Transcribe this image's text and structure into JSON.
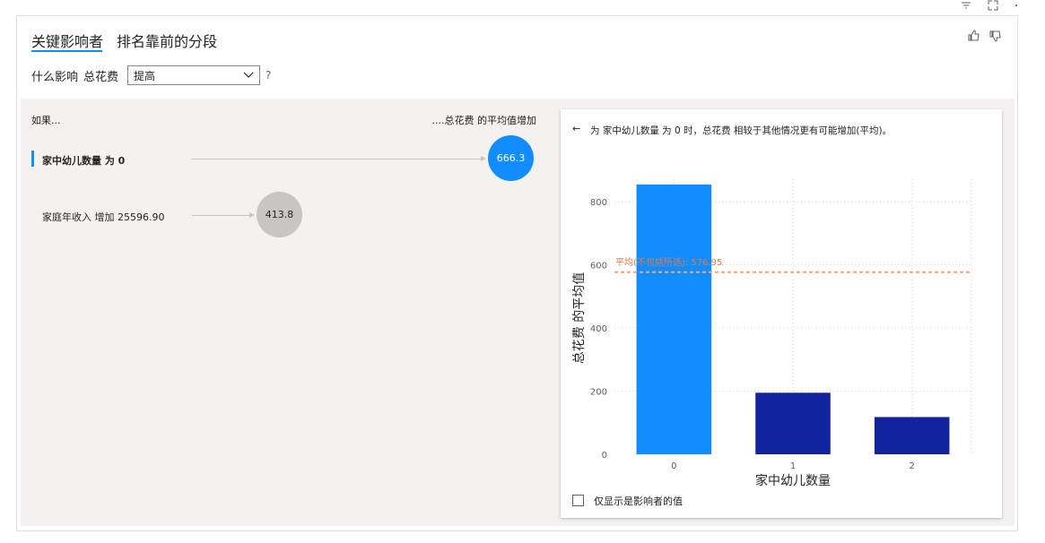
{
  "tabs": [
    {
      "label": "关键影响者",
      "active": true
    },
    {
      "label": "排名靠前的分段",
      "active": false
    }
  ],
  "header_icons": [
    "filter-icon",
    "focus-mode-icon",
    "more-options-icon"
  ],
  "feedback_icons": [
    "thumbs-up-icon",
    "thumbs-down-icon"
  ],
  "what_influences": {
    "label": "什么影响",
    "field": "总花费",
    "selected": "提高",
    "help": "?"
  },
  "left_panel": {
    "if_header": "如果...",
    "then_header": "....总花费 的平均值增加",
    "influencers": [
      {
        "label": "家中幼儿数量 为 0",
        "value": "666.3",
        "selected": true,
        "color": "#118dff"
      },
      {
        "label": "家庭年收入 增加 25596.90",
        "value": "413.8",
        "selected": false,
        "color": "#c8c6c4"
      }
    ]
  },
  "detail": {
    "back_arrow": "←",
    "description": "为 家中幼儿数量 为 0 时，总花费 相较于其他情况更有可能增加(平均)。",
    "checkbox_label": "仅显示是影响者的值",
    "checkbox_checked": false
  },
  "chart_data": {
    "type": "bar",
    "categories": [
      "0",
      "1",
      "2"
    ],
    "values": [
      855,
      195,
      118
    ],
    "bar_colors": [
      "#118dff",
      "#12239e",
      "#12239e"
    ],
    "xlabel": "家中幼儿数量",
    "ylabel": "总花费 的平均值",
    "ylim": [
      0,
      900
    ],
    "yticks": [
      0,
      200,
      400,
      600,
      800
    ],
    "grid": true,
    "reference_line": {
      "label": "平均(不包括所选): 576.95",
      "value": 576.95,
      "color": "#f2a37a"
    }
  }
}
